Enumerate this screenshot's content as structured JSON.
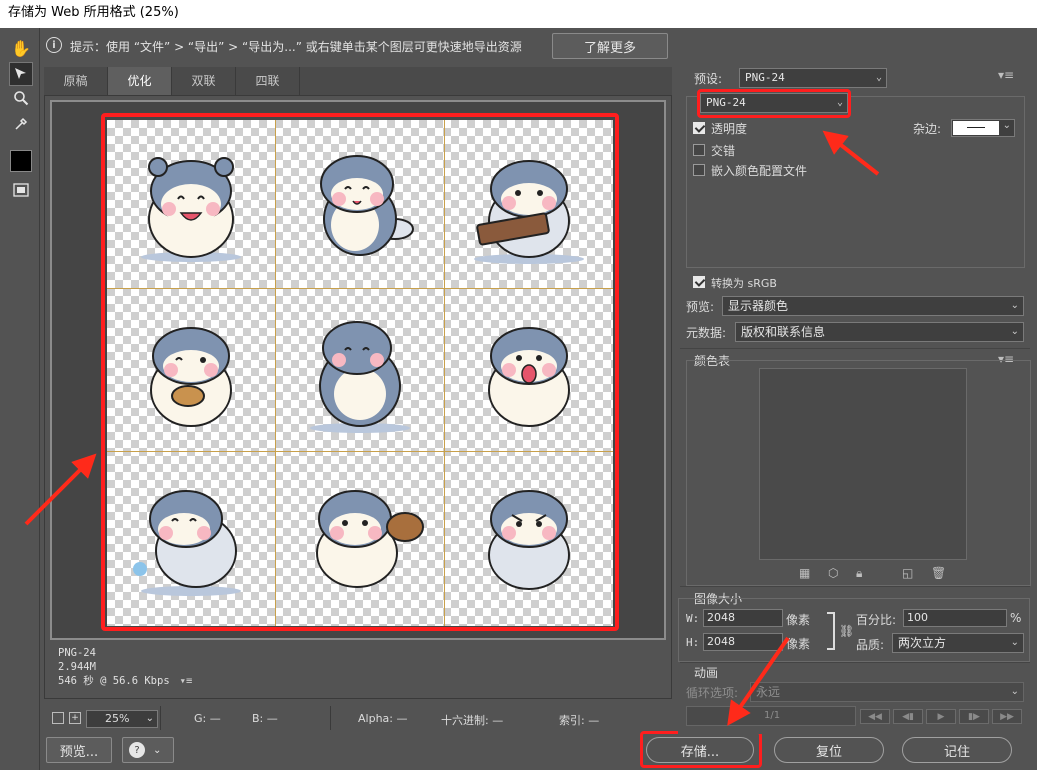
{
  "window": {
    "title": "存储为 Web 所用格式 (25%)"
  },
  "hint": {
    "text": "提示：使用 “文件” > “导出” > “导出为...” 或右键单击某个图层可更快速地导出资源",
    "learn_more": "了解更多"
  },
  "tabs": [
    {
      "label": "原稿"
    },
    {
      "label": "优化"
    },
    {
      "label": "双联"
    },
    {
      "label": "四联"
    }
  ],
  "image_info": {
    "format": "PNG-24",
    "size": "2.944M",
    "speed": "546 秒 @ 56.6 Kbps"
  },
  "status": {
    "zoom": "25%",
    "g": "G: —",
    "b": "B: —",
    "alpha": "Alpha: —",
    "hex": "十六进制: —",
    "index": "索引: —"
  },
  "bottom_buttons": {
    "preview": "预览...",
    "save": "存储...",
    "reset": "复位",
    "remember": "记住"
  },
  "settings": {
    "preset_label": "预设:",
    "preset_value": "PNG-24",
    "format_value": "PNG-24",
    "transparency_label": "透明度",
    "transparency_checked": true,
    "interlaced_label": "交错",
    "interlaced_checked": false,
    "embed_profile_label": "嵌入颜色配置文件",
    "embed_profile_checked": false,
    "matte_label": "杂边:",
    "convert_srgb_label": "转换为 sRGB",
    "convert_srgb_checked": true,
    "preview_label": "预览:",
    "preview_value": "显示器颜色",
    "metadata_label": "元数据:",
    "metadata_value": "版权和联系信息",
    "color_table_label": "颜色表"
  },
  "image_size": {
    "section_label": "图像大小",
    "w_label": "W:",
    "w_value": "2048",
    "h_label": "H:",
    "h_value": "2048",
    "unit": "像素",
    "percent_label": "百分比:",
    "percent_value": "100",
    "percent_unit": "%",
    "quality_label": "品质:",
    "quality_value": "两次立方"
  },
  "animation": {
    "section_label": "动画",
    "loop_label": "循环选项:",
    "loop_value": "永远",
    "frame_counter": "1/1"
  },
  "colors": {
    "highlight": "#ff1e1e",
    "panel_bg": "#535353"
  }
}
